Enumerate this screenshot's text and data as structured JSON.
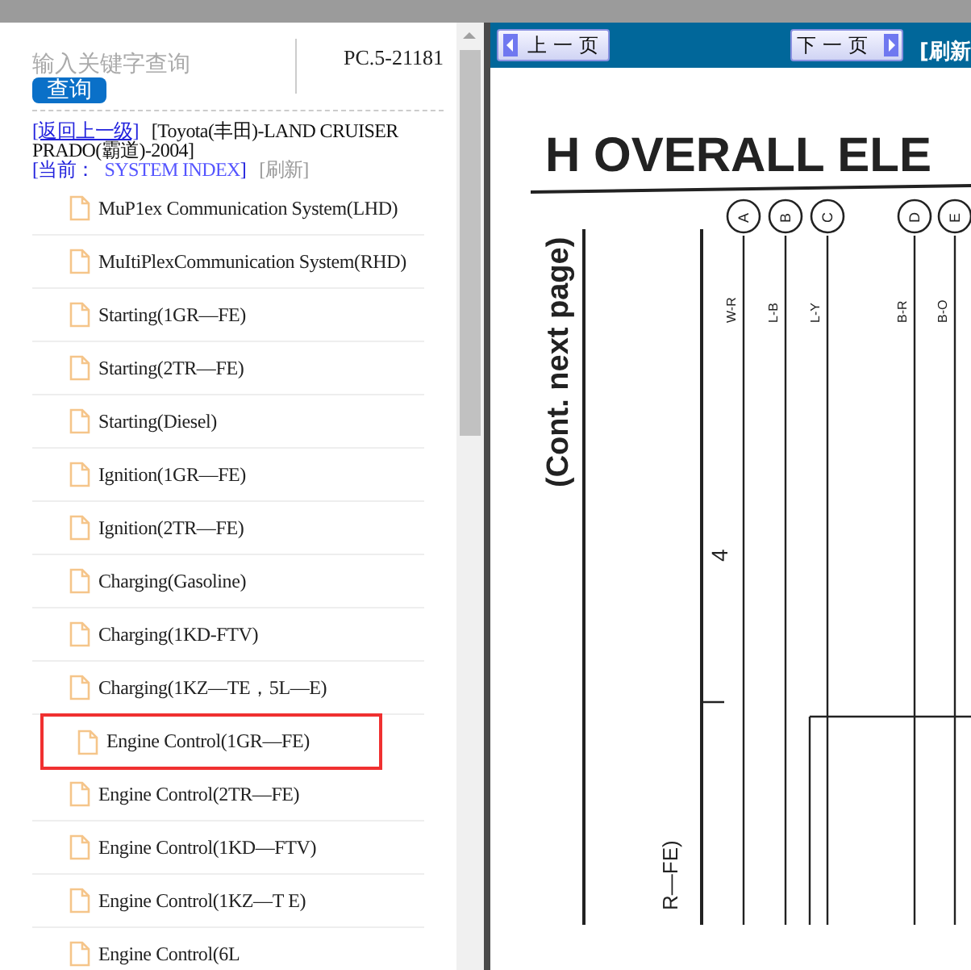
{
  "search": {
    "placeholder": "输入关键字查询",
    "button": "查询"
  },
  "code": "PC.5-21181",
  "breadcrumb": {
    "back": "[返回上一级]",
    "path": "[Toyota(丰田)-LAND CRUISER PRADO(霸道)-2004]",
    "current_label": "[当前：",
    "current": "SYSTEM INDEX",
    "current_close": "]",
    "refresh": "[刷新]"
  },
  "items": [
    {
      "label": "MuP1ex Communication System(LHD)",
      "selected": false
    },
    {
      "label": "MuItiPlexCommunication System(RHD)",
      "selected": false
    },
    {
      "label": "Starting(1GR—FE)",
      "selected": false
    },
    {
      "label": "Starting(2TR—FE)",
      "selected": false
    },
    {
      "label": "Starting(Diesel)",
      "selected": false
    },
    {
      "label": "Ignition(1GR—FE)",
      "selected": false
    },
    {
      "label": "Ignition(2TR—FE)",
      "selected": false
    },
    {
      "label": "Charging(Gasoline)",
      "selected": false
    },
    {
      "label": "Charging(1KD-FTV)",
      "selected": false
    },
    {
      "label": "Charging(1KZ—TE，5L—E)",
      "selected": false
    },
    {
      "label": "Engine Control(1GR—FE)",
      "selected": true
    },
    {
      "label": "Engine Control(2TR—FE)",
      "selected": false
    },
    {
      "label": "Engine Control(1KD—FTV)",
      "selected": false
    },
    {
      "label": "Engine Control(1KZ—T E)",
      "selected": false
    },
    {
      "label": "Engine Control(6L",
      "selected": false
    }
  ],
  "toolbar": {
    "prev": "上一页",
    "next": "下一页",
    "refresh": "[刷新"
  },
  "diagram": {
    "heading": "H  OVERALL ELE",
    "side_note": "(Cont.   next page)",
    "number": "4",
    "partial_label": "R—FE)",
    "connectors": [
      {
        "letter": "A",
        "wire": "W-R"
      },
      {
        "letter": "B",
        "wire": "L-B"
      },
      {
        "letter": "C",
        "wire": "L-Y"
      },
      {
        "letter": "D",
        "wire": "B-R"
      },
      {
        "letter": "E",
        "wire": "B-O"
      }
    ]
  }
}
